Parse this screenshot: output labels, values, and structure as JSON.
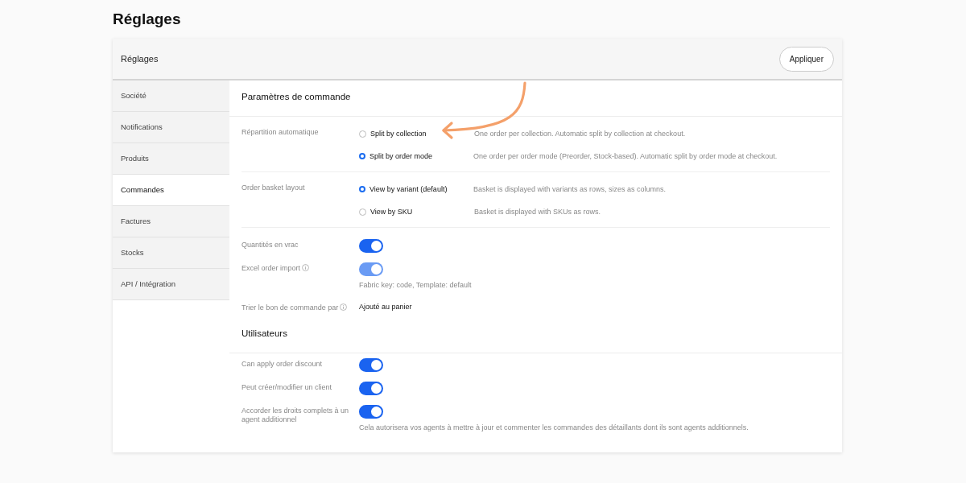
{
  "page_title": "Réglages",
  "card": {
    "title": "Réglages",
    "apply_button": "Appliquer"
  },
  "sidebar": {
    "items": [
      {
        "label": "Société",
        "selected": false
      },
      {
        "label": "Notifications",
        "selected": false
      },
      {
        "label": "Produits",
        "selected": false
      },
      {
        "label": "Commandes",
        "selected": true
      },
      {
        "label": "Factures",
        "selected": false
      },
      {
        "label": "Stocks",
        "selected": false
      },
      {
        "label": "API / Intégration",
        "selected": false
      }
    ]
  },
  "sections": [
    {
      "title": "Paramètres de commande",
      "settings": [
        {
          "kind": "radio",
          "label": "Répartition automatique",
          "options": [
            {
              "label": "Split by collection",
              "selected": false,
              "description": "One order per collection. Automatic split by collection at checkout."
            },
            {
              "label": "Split by order mode",
              "selected": true,
              "description": "One order per order mode (Preorder, Stock-based). Automatic split by order mode at checkout."
            }
          ]
        },
        {
          "kind": "radio",
          "label": "Order basket layout",
          "options": [
            {
              "label": "View by variant (default)",
              "selected": true,
              "description": "Basket is displayed with variants as rows, sizes as columns."
            },
            {
              "label": "View by SKU",
              "selected": false,
              "description": "Basket is displayed with SKUs as rows."
            }
          ]
        },
        {
          "kind": "toggle",
          "label": "Quantités en vrac",
          "info": false,
          "on": true,
          "disabled": false
        },
        {
          "kind": "toggle",
          "label": "Excel order import",
          "info": true,
          "on": true,
          "disabled": true,
          "note": "Fabric key: code, Template: default"
        },
        {
          "kind": "value",
          "label": "Trier le bon de commande par",
          "info": true,
          "value": "Ajouté au panier"
        }
      ]
    },
    {
      "title": "Utilisateurs",
      "settings": [
        {
          "kind": "toggle",
          "label": "Can apply order discount",
          "info": false,
          "on": true,
          "disabled": false
        },
        {
          "kind": "toggle",
          "label": "Peut créer/modifier un client",
          "info": false,
          "on": true,
          "disabled": false
        },
        {
          "kind": "toggle",
          "label": "Accorder les droits complets à un agent additionnel",
          "info": false,
          "on": true,
          "disabled": false,
          "note": "Cela autorisera vos agents à mettre à jour et commenter les commandes des détaillants dont ils sont agents additionnels."
        }
      ]
    }
  ]
}
